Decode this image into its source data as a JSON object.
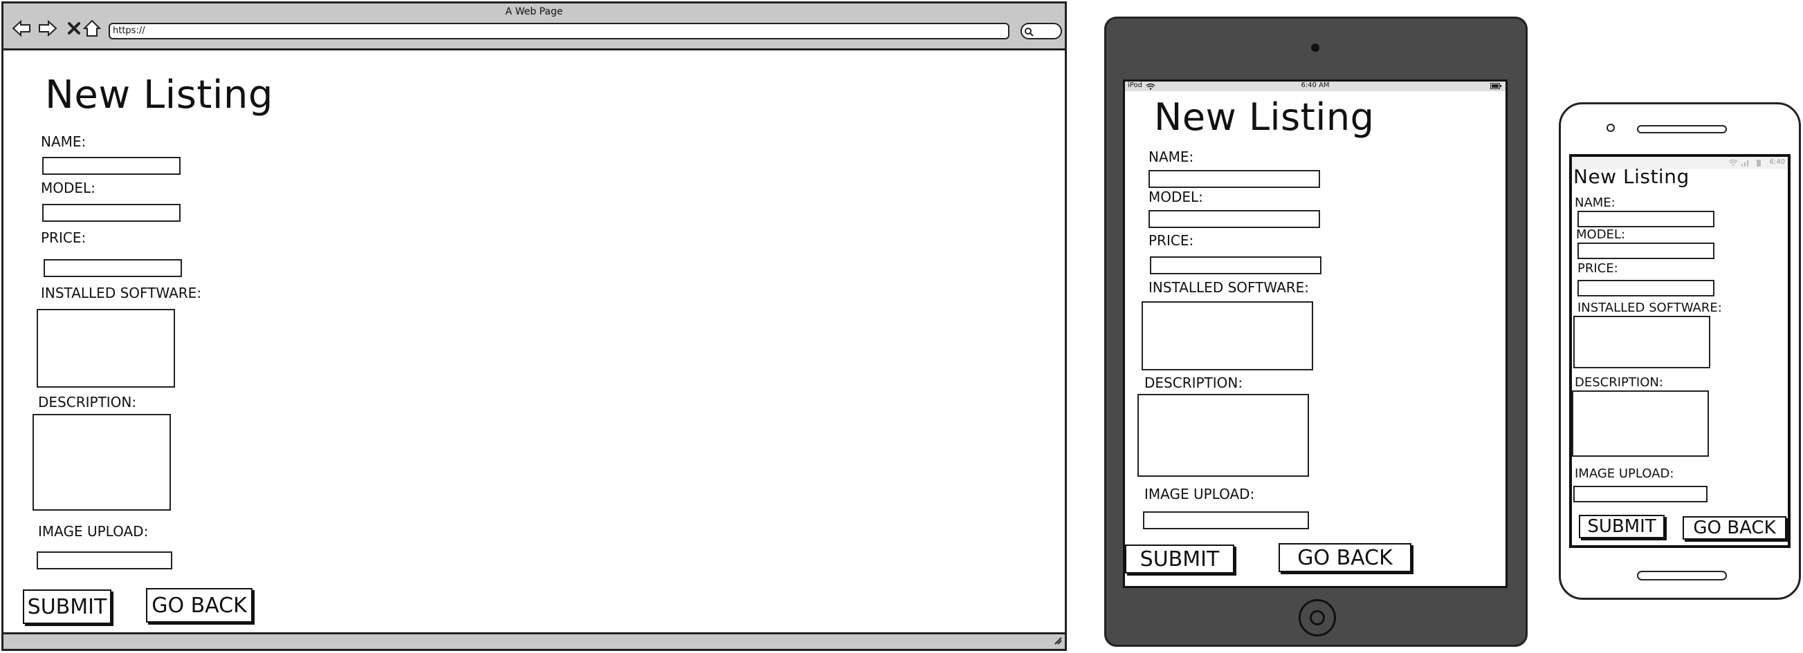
{
  "browser": {
    "window_title": "A Web Page",
    "url": "https://",
    "nav_icons": [
      "back-arrow-icon",
      "forward-arrow-icon",
      "close-x-icon",
      "home-icon"
    ],
    "search_icon": "search-icon"
  },
  "tablet": {
    "status": {
      "carrier": "iPod",
      "time": "6:40 AM"
    }
  },
  "phone": {
    "status": {
      "time": "6:40"
    }
  },
  "form": {
    "title": "New Listing",
    "name_label": "NAME:",
    "model_label": "MODEL:",
    "price_label": "PRICE:",
    "software_label": "INSTALLED SOFTWARE:",
    "description_label": "DESCRIPTION:",
    "image_label": "IMAGE UPLOAD:",
    "submit_label": "SUBMIT",
    "back_label": "GO BACK"
  },
  "colors": {
    "chrome_gray": "#c8c8c8",
    "tablet_body": "#4a4a4a",
    "ink": "#111111"
  }
}
